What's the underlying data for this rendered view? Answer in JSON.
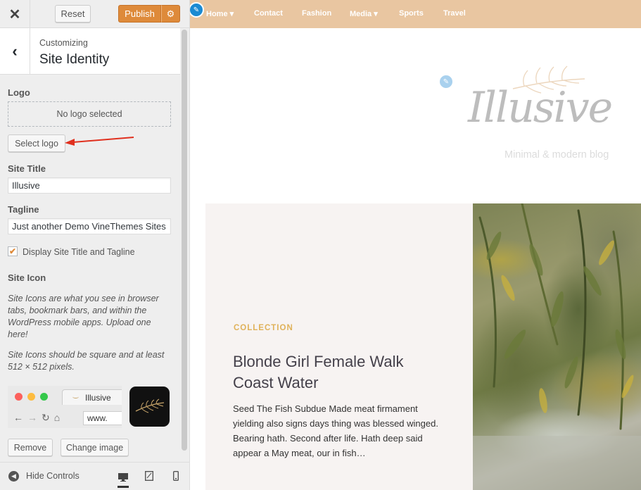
{
  "topbar": {
    "close_icon": "close-icon",
    "reset_label": "Reset",
    "publish_label": "Publish",
    "settings_icon": "gear-icon"
  },
  "section": {
    "crumb": "Customizing",
    "title": "Site Identity",
    "back_icon": "chevron-left-icon"
  },
  "logo": {
    "label": "Logo",
    "placeholder": "No logo selected",
    "select_label": "Select logo"
  },
  "site_title": {
    "label": "Site Title",
    "value": "Illusive"
  },
  "tagline": {
    "label": "Tagline",
    "value": "Just another Demo VineThemes Sites"
  },
  "display_title": {
    "checked": true,
    "label": "Display Site Title and Tagline"
  },
  "site_icon": {
    "label": "Site Icon",
    "desc1": "Site Icons are what you see in browser tabs, bookmark bars, and within the WordPress mobile apps. Upload one here!",
    "desc2": "Site Icons should be square and at least 512 × 512 pixels.",
    "preview_tab_title": "Illusive",
    "preview_url": "www.",
    "remove_label": "Remove",
    "change_label": "Change image"
  },
  "footer": {
    "hide_label": "Hide Controls",
    "devices": [
      "desktop",
      "tablet",
      "mobile"
    ]
  },
  "preview": {
    "nav": [
      "Home",
      "Contact",
      "Fashion",
      "Media",
      "Sports",
      "Travel"
    ],
    "logo_text": "Illusive",
    "logo_tagline": "Minimal & modern blog",
    "post": {
      "category": "COLLECTION",
      "title": "Blonde Girl Female Walk Coast Water",
      "excerpt": "Seed The Fish Subdue Made meat firmament yielding also signs days thing was blessed winged. Bearing hath. Second after life. Hath deep said appear a May meat, our in fish…"
    }
  },
  "colors": {
    "accent": "#de8a3a",
    "navbar": "#e9c6a1",
    "edit_blue": "#1a8ad2",
    "category": "#e0b25a"
  }
}
